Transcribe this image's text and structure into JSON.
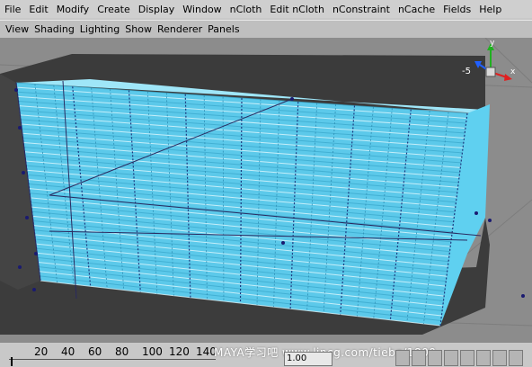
{
  "menubar": {
    "items": [
      "File",
      "Edit",
      "Modify",
      "Create",
      "Display",
      "Window",
      "nCloth",
      "Edit nCloth",
      "nConstraint",
      "nCache",
      "Fields",
      "Help"
    ]
  },
  "panel_menu": {
    "items": [
      "View",
      "Shading",
      "Lighting",
      "Show",
      "Renderer",
      "Panels"
    ]
  },
  "view_cube": {
    "axis_y": "y",
    "axis_x": "x",
    "axis_z": "-5",
    "colors": {
      "x": "#e02020",
      "y": "#20b020",
      "z": "#2060ff"
    }
  },
  "timeline": {
    "ticks": [
      "20",
      "40",
      "60",
      "80",
      "100",
      "120",
      "140"
    ],
    "current_time": "1.00",
    "watermark": "MAYA学习吧  www.lincg.com/tiebq/1800"
  },
  "scene": {
    "box_side_color": "#5fd0f0",
    "shadow_color": "#3c3c3c",
    "ground_color": "#8a8a8a"
  }
}
